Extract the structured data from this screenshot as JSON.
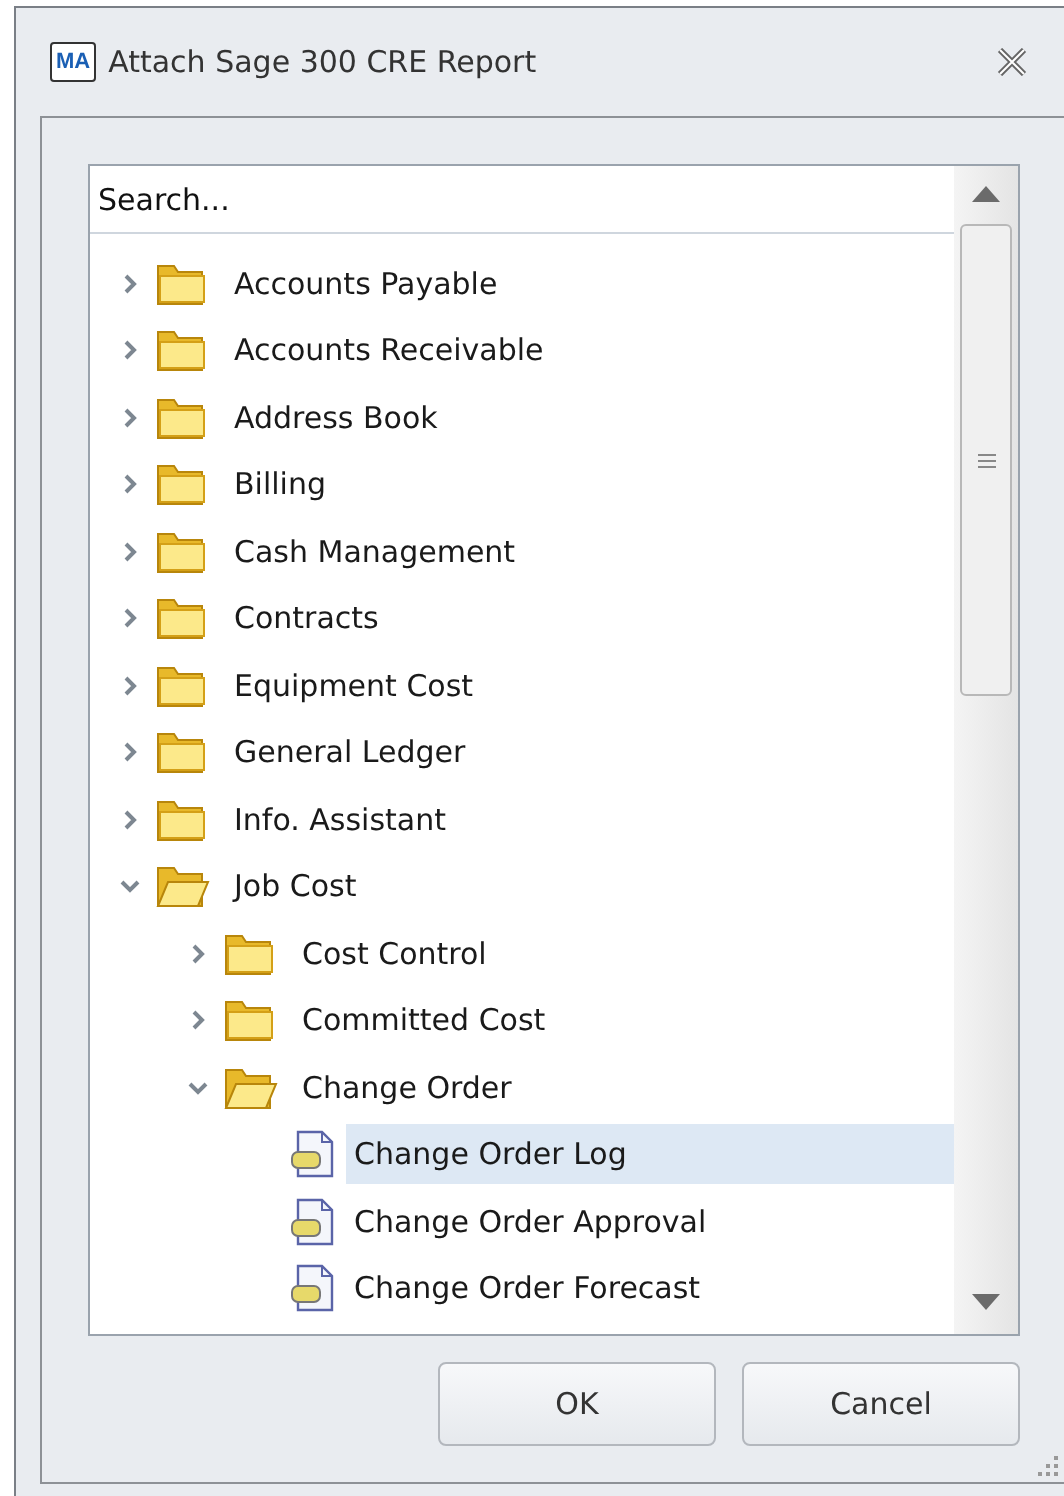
{
  "window": {
    "title": "Attach Sage 300 CRE Report",
    "app_badge": "MA"
  },
  "search": {
    "placeholder": "Search..."
  },
  "tree": [
    {
      "label": "Accounts Payable",
      "kind": "folder",
      "expanded": false,
      "selected": false
    },
    {
      "label": "Accounts Receivable",
      "kind": "folder",
      "expanded": false,
      "selected": false
    },
    {
      "label": "Address Book",
      "kind": "folder",
      "expanded": false,
      "selected": false
    },
    {
      "label": "Billing",
      "kind": "folder",
      "expanded": false,
      "selected": false
    },
    {
      "label": "Cash Management",
      "kind": "folder",
      "expanded": false,
      "selected": false
    },
    {
      "label": "Contracts",
      "kind": "folder",
      "expanded": false,
      "selected": false
    },
    {
      "label": "Equipment Cost",
      "kind": "folder",
      "expanded": false,
      "selected": false
    },
    {
      "label": "General Ledger",
      "kind": "folder",
      "expanded": false,
      "selected": false
    },
    {
      "label": "Info. Assistant",
      "kind": "folder",
      "expanded": false,
      "selected": false
    },
    {
      "label": "Job Cost",
      "kind": "folder",
      "expanded": true,
      "selected": false,
      "children": [
        {
          "label": "Cost Control",
          "kind": "folder",
          "expanded": false,
          "selected": false
        },
        {
          "label": "Committed Cost",
          "kind": "folder",
          "expanded": false,
          "selected": false
        },
        {
          "label": "Change Order",
          "kind": "folder",
          "expanded": true,
          "selected": false,
          "children": [
            {
              "label": "Change Order Log",
              "kind": "report",
              "selected": true
            },
            {
              "label": "Change Order Approval",
              "kind": "report",
              "selected": false
            },
            {
              "label": "Change Order Forecast",
              "kind": "report",
              "selected": false
            }
          ]
        }
      ]
    }
  ],
  "buttons": [
    {
      "label": "OK"
    },
    {
      "label": "Cancel"
    }
  ]
}
